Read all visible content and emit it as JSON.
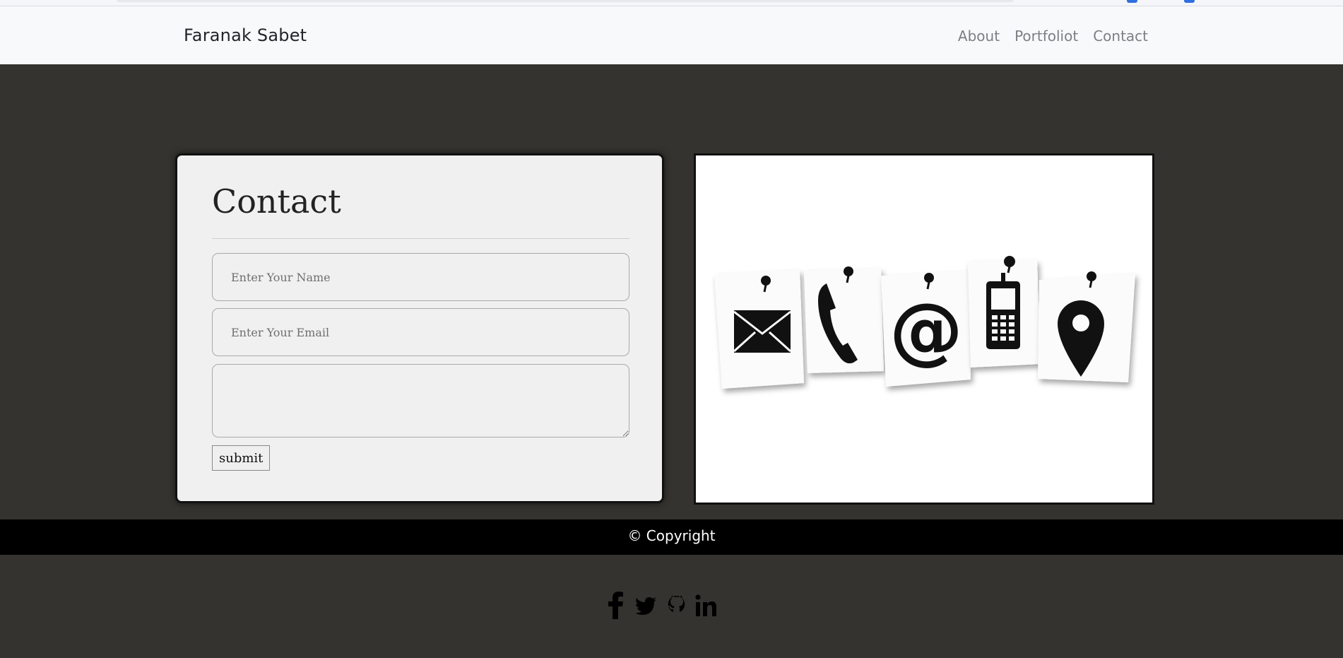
{
  "navbar": {
    "brand": "Faranak Sabet",
    "links": [
      "About",
      "Portfoliot",
      "Contact"
    ]
  },
  "contact": {
    "title": "Contact",
    "name_placeholder": "Enter Your Name",
    "email_placeholder": "Enter Your Email",
    "message_value": "",
    "submit_label": "submit"
  },
  "image": {
    "icons": [
      "envelope-icon",
      "phone-icon",
      "at-sign-icon",
      "mobile-phone-icon",
      "location-pin-icon"
    ]
  },
  "footer": {
    "copyright": "© Copyright"
  },
  "social": {
    "icons": [
      "facebook-icon",
      "twitter-icon",
      "github-icon",
      "linkedin-icon"
    ]
  },
  "colors": {
    "page_bg": "#35332f",
    "navbar_bg": "#f8f9fa",
    "card_bg": "#f0f0f0",
    "footer_bg": "#000000"
  }
}
